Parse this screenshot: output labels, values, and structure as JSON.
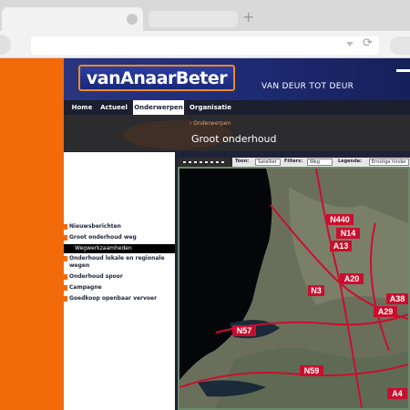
{
  "browser": {
    "active_tab_title": "",
    "new_tab_symbol": "+",
    "reload_symbol": "⟳",
    "address": ""
  },
  "site": {
    "logo_text": "vanAnaarBeter",
    "tagline": "VAN DEUR TOT DEUR",
    "nav": [
      {
        "label": "Home",
        "active": false
      },
      {
        "label": "Actueel",
        "active": false
      },
      {
        "label": "Onderwerpen",
        "active": true
      },
      {
        "label": "Organisatie",
        "active": false
      }
    ],
    "breadcrumb": "› Onderwerpen",
    "page_title": "Groot onderhoud",
    "sidebar": [
      "Nieuwsberichten",
      "Groot onderhoud weg",
      "Onderhoud lokale en regionale wegen",
      "Onderhoud spoor",
      "Campagne",
      "Goedkoop openbaar vervoer"
    ],
    "sidebar_sub": "Wegwerkzaamheden",
    "map_toolbar": {
      "toon_label": "Toon:",
      "toon_value": "Satelliet",
      "filters_label": "Filters:",
      "filters_value": "Weg",
      "legenda_label": "Legenda:",
      "legenda_value": "Ernstige hinder"
    },
    "road_labels": [
      "N440",
      "N14",
      "A13",
      "A20",
      "N3",
      "A38",
      "A29",
      "N57",
      "N59",
      "A4"
    ]
  },
  "colors": {
    "brand_orange": "#f26a0a",
    "site_navy": "#1d2238",
    "road_red": "#c8102e"
  },
  "icons": {
    "new_tab": "plus-icon",
    "reload": "reload-icon",
    "omnibox_dropdown": "chevron-down-icon"
  }
}
